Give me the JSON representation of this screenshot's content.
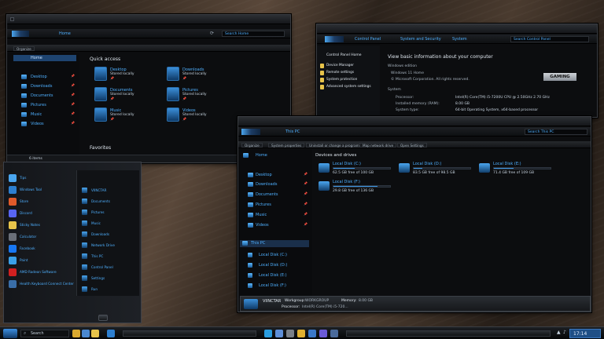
{
  "explorer_home": {
    "address": "Home",
    "search_placeholder": "Search Home",
    "organize": "Organize",
    "nav": [
      {
        "label": "Home",
        "icon": "home-icon"
      },
      {
        "label": "Desktop",
        "icon": "desktop-icon"
      },
      {
        "label": "Downloads",
        "icon": "downloads-icon"
      },
      {
        "label": "Documents",
        "icon": "documents-icon"
      },
      {
        "label": "Pictures",
        "icon": "pictures-icon"
      },
      {
        "label": "Music",
        "icon": "music-icon"
      },
      {
        "label": "Videos",
        "icon": "videos-icon"
      }
    ],
    "quick_access_heading": "Quick access",
    "quick_access": [
      {
        "name": "Desktop",
        "sub": "Stored locally"
      },
      {
        "name": "Downloads",
        "sub": "Stored locally"
      },
      {
        "name": "Documents",
        "sub": "Stored locally"
      },
      {
        "name": "Pictures",
        "sub": "Stored locally"
      },
      {
        "name": "Music",
        "sub": "Stored locally"
      },
      {
        "name": "Videos",
        "sub": "Stored locally"
      }
    ],
    "favorites_heading": "Favorites",
    "status": "6 items"
  },
  "control_panel": {
    "breadcrumb": [
      "Control Panel",
      "System and Security",
      "System"
    ],
    "search_placeholder": "Search Control Panel",
    "sidebar": [
      "Control Panel Home",
      "Device Manager",
      "Remote settings",
      "System protection",
      "Advanced system settings"
    ],
    "title": "View basic information about your computer",
    "edition_heading": "Windows edition",
    "edition": "Windows 11 Home",
    "copyright": "© Microsoft Corporation. All rights reserved.",
    "system_heading": "System",
    "brand": "GAMING",
    "rows": [
      {
        "label": "Processor:",
        "value": "Intel(R) Core(TM) i5-7200U CPU @ 2.50GHz   2.70 GHz"
      },
      {
        "label": "Installed memory (RAM):",
        "value": "8.00 GB"
      },
      {
        "label": "System type:",
        "value": "64-bit Operating System, x64-based processor"
      }
    ]
  },
  "this_pc": {
    "address": "This PC",
    "search_placeholder": "Search This PC",
    "toolbar": [
      "Organize",
      "System properties",
      "Uninstall or change a program",
      "Map network drive",
      "Open Settings"
    ],
    "nav": [
      {
        "label": "Home",
        "icon": "home-icon"
      },
      {
        "label": "Desktop",
        "icon": "desktop-icon"
      },
      {
        "label": "Downloads",
        "icon": "downloads-icon"
      },
      {
        "label": "Documents",
        "icon": "documents-icon"
      },
      {
        "label": "Pictures",
        "icon": "pictures-icon"
      },
      {
        "label": "Music",
        "icon": "music-icon"
      },
      {
        "label": "Videos",
        "icon": "videos-icon"
      }
    ],
    "nav_tree_root": "This PC",
    "nav_drives": [
      "Local Disk (C:)",
      "Local Disk (D:)",
      "Local Disk (E:)",
      "Local Disk (F:)"
    ],
    "drives_heading": "Devices and drives",
    "drives": [
      {
        "name": "Local Disk (C:)",
        "free": "62.5 GB free of 100 GB",
        "used_fraction": 0.375
      },
      {
        "name": "Local Disk (D:)",
        "free": "83.5 GB free of 98.5 GB",
        "used_fraction": 0.15
      },
      {
        "name": "Local Disk (E:)",
        "free": "71.4 GB free of 109 GB",
        "used_fraction": 0.35
      },
      {
        "name": "Local Disk (F:)",
        "free": "29.8 GB free of 136 GB",
        "used_fraction": 0.78
      }
    ],
    "details": {
      "computer": "VIINCTAR",
      "workgroup_label": "Workgroup:",
      "workgroup": "WORKGROUP",
      "memory_label": "Memory:",
      "memory": "8.00 GB",
      "processor_label": "Processor:",
      "processor": "Intel(R) Core(TM) i5-720..."
    }
  },
  "start_menu": {
    "pinned": [
      {
        "label": "Tips",
        "color": "#4aa6f0"
      },
      {
        "label": "Windows Tool",
        "color": "#2d7fd0"
      },
      {
        "label": "Store",
        "color": "#e05a2a"
      },
      {
        "label": "Discord",
        "color": "#5865f2"
      },
      {
        "label": "Sticky Notes",
        "color": "#e8c44a"
      },
      {
        "label": "Calculator",
        "color": "#6a6f78"
      },
      {
        "label": "Facebook",
        "color": "#1877f2"
      },
      {
        "label": "Paint",
        "color": "#3aa0e8"
      },
      {
        "label": "AMD Radeon Software",
        "color": "#d02020"
      },
      {
        "label": "Health Keyboard Connect Center",
        "color": "#3a6ea8"
      }
    ],
    "right": [
      "VIINCTAR",
      "Documents",
      "Pictures",
      "Music",
      "Downloads",
      "Network Drive",
      "This PC",
      "Control Panel",
      "Settings",
      "Run"
    ]
  },
  "taskbar": {
    "search": "Search",
    "time": "17:14"
  }
}
